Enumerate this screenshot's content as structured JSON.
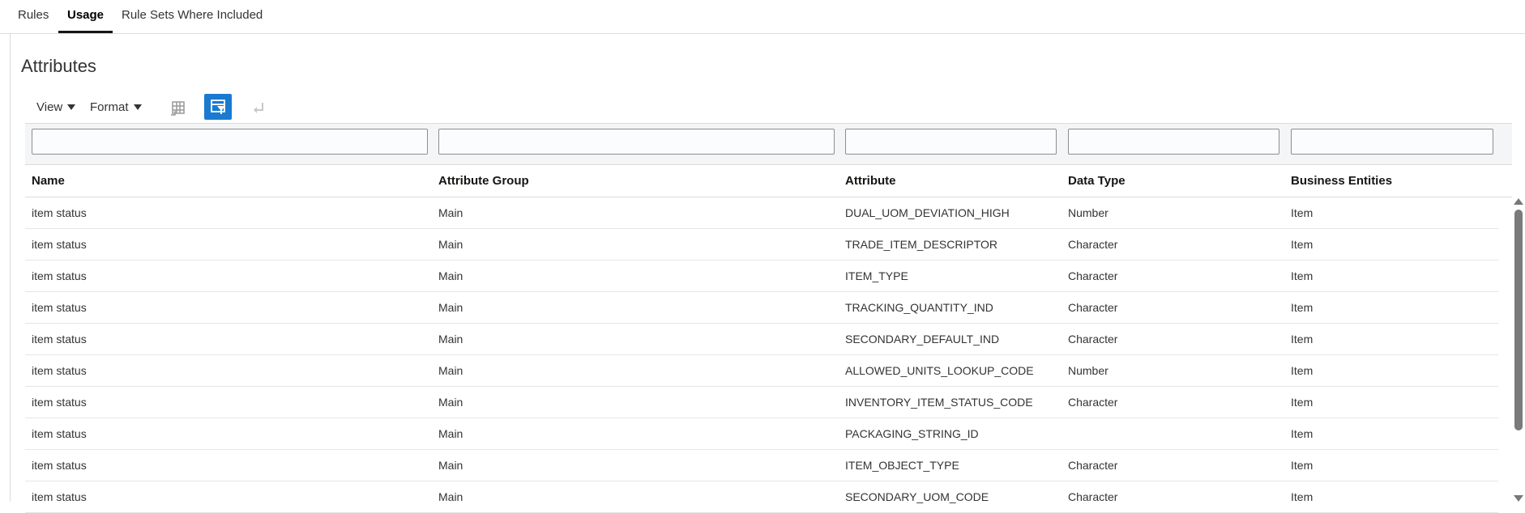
{
  "tabs": [
    {
      "label": "Rules"
    },
    {
      "label": "Usage"
    },
    {
      "label": "Rule Sets Where Included"
    }
  ],
  "active_tab": "Usage",
  "panel": {
    "title": "Attributes"
  },
  "toolbar": {
    "view_label": "View",
    "format_label": "Format",
    "icons": [
      "freeze-columns-icon",
      "query-by-example-icon",
      "wrap-icon"
    ]
  },
  "accent_color": "#1a7ad0",
  "table": {
    "columns": [
      "Name",
      "Attribute Group",
      "Attribute",
      "Data Type",
      "Business Entities"
    ],
    "filters": [
      "",
      "",
      "",
      "",
      ""
    ],
    "rows": [
      [
        "item status",
        "Main",
        "DUAL_UOM_DEVIATION_HIGH",
        "Number",
        "Item"
      ],
      [
        "item status",
        "Main",
        "TRADE_ITEM_DESCRIPTOR",
        "Character",
        "Item"
      ],
      [
        "item status",
        "Main",
        "ITEM_TYPE",
        "Character",
        "Item"
      ],
      [
        "item status",
        "Main",
        "TRACKING_QUANTITY_IND",
        "Character",
        "Item"
      ],
      [
        "item status",
        "Main",
        "SECONDARY_DEFAULT_IND",
        "Character",
        "Item"
      ],
      [
        "item status",
        "Main",
        "ALLOWED_UNITS_LOOKUP_CODE",
        "Number",
        "Item"
      ],
      [
        "item status",
        "Main",
        "INVENTORY_ITEM_STATUS_CODE",
        "Character",
        "Item"
      ],
      [
        "item status",
        "Main",
        "PACKAGING_STRING_ID",
        "",
        "Item"
      ],
      [
        "item status",
        "Main",
        "ITEM_OBJECT_TYPE",
        "Character",
        "Item"
      ],
      [
        "item status",
        "Main",
        "SECONDARY_UOM_CODE",
        "Character",
        "Item"
      ]
    ]
  }
}
